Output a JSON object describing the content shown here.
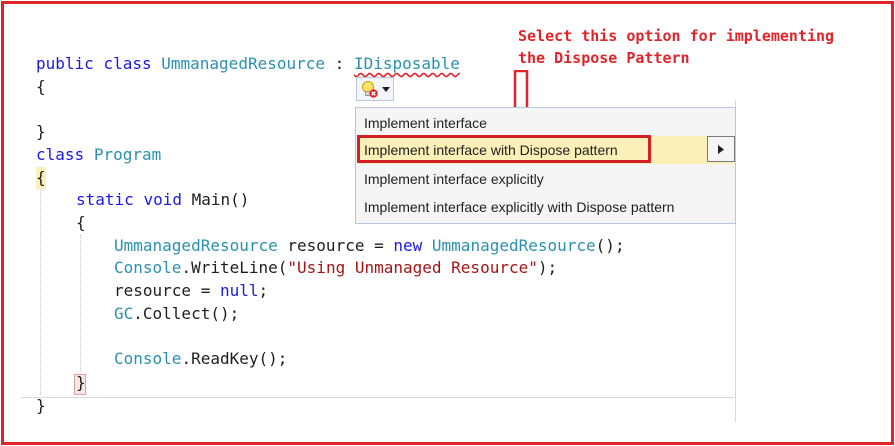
{
  "code": {
    "line1": {
      "kw_public": "public",
      "kw_class": "class",
      "class_name": "UmmanagedResource",
      "colon": ":",
      "interface": "IDisposable"
    },
    "open_brace_1": "{",
    "close_brace_1": "}",
    "line4": {
      "kw_class": "class",
      "class_name": "Program"
    },
    "open_brace_2": "{",
    "main_sig": {
      "kw_static": "static",
      "kw_void": "void",
      "name": "Main()"
    },
    "open_brace_3": "{",
    "stmt1": {
      "type": "UmmanagedResource",
      "rest": " resource = ",
      "kw_new": "new",
      "ctor": "UmmanagedResource",
      "end": "();"
    },
    "stmt2": {
      "type": "Console",
      "method": ".WriteLine(",
      "string": "\"Using Unmanaged Resource\"",
      "end": ");"
    },
    "stmt3": {
      "lhs": "resource = ",
      "kw_null": "null",
      "end": ";"
    },
    "stmt4": {
      "type": "GC",
      "rest": ".Collect();"
    },
    "stmt5": {
      "type": "Console",
      "rest": ".ReadKey();"
    },
    "close_brace_3": "}",
    "close_brace_2": "}"
  },
  "annotation": {
    "line1": "Select this option for implementing",
    "line2": "the Dispose Pattern"
  },
  "quick_actions": {
    "items": [
      {
        "label": "Implement interface"
      },
      {
        "label": "Implement interface with Dispose pattern"
      },
      {
        "label": "Implement interface explicitly"
      },
      {
        "label": "Implement interface explicitly with Dispose pattern"
      }
    ],
    "selected_index": 1
  },
  "colors": {
    "annotation_red": "#e0242a",
    "keyword_blue": "#1a1adf",
    "type_teal": "#2b91af",
    "string_red": "#a31515",
    "selected_row": "#fbf1b8"
  }
}
